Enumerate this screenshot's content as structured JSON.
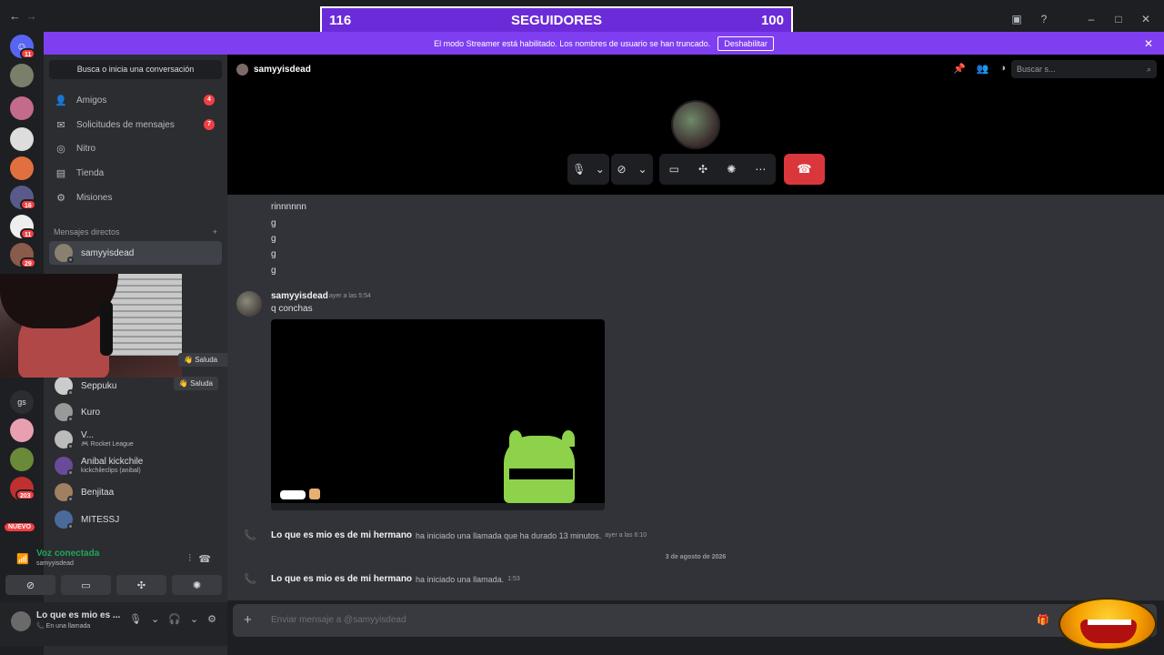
{
  "overlay": {
    "followers_left": "116",
    "followers_title": "SEGUIDORES",
    "followers_right": "100"
  },
  "titlebar": {
    "back_icon": "arrow-left-icon",
    "forward_icon": "arrow-right-icon"
  },
  "banner": {
    "text": "El modo Streamer está habilitado. Los nombres de usuario se han truncado.",
    "button": "Deshabilitar"
  },
  "servers": {
    "badges": [
      "11",
      "16",
      "11",
      "29",
      "203"
    ],
    "gs_label": "gs",
    "new_label": "NUEVO"
  },
  "dm_panel": {
    "search_placeholder": "Busca o inicia una conversación",
    "nav": [
      {
        "label": "Amigos",
        "badge": "4",
        "icon": "people-icon"
      },
      {
        "label": "Solicitudes de mensajes",
        "badge": "7",
        "icon": "mail-icon"
      },
      {
        "label": "Nitro",
        "icon": "nitro-icon"
      },
      {
        "label": "Tienda",
        "icon": "shop-icon"
      },
      {
        "label": "Misiones",
        "icon": "quest-icon"
      }
    ],
    "dm_header": "Mensajes directos",
    "dms": [
      {
        "name": "samyyisdead",
        "sub": ""
      },
      {
        "name": "Seppuku",
        "sub": ""
      },
      {
        "name": "Kuro",
        "sub": ""
      },
      {
        "name": "V...",
        "sub": "Rocket League"
      },
      {
        "name": "Anibal kickchile",
        "sub": "kickchileclips (anibal)"
      },
      {
        "name": "Benjitaa",
        "sub": ""
      },
      {
        "name": "MITESSJ",
        "sub": ""
      }
    ],
    "saluda_label": "Saluda"
  },
  "voice": {
    "title": "Voz conectada",
    "channel": "samyyisdead"
  },
  "user": {
    "name": "Lo que es mio es ...",
    "status": "En una llamada"
  },
  "header": {
    "channel_name": "samyyisdead",
    "search_placeholder": "Buscar s..."
  },
  "chat": {
    "early_lines": [
      "rinnnnnn",
      "g",
      "g",
      "g",
      "g"
    ],
    "author": "samyyisdead",
    "timestamp": "ayer a las 5:54",
    "message": "q conchas",
    "call1": {
      "who": "Lo que es mio es de mi hermano",
      "text": "ha iniciado una llamada que ha durado 13 minutos.",
      "time": "ayer a las 6:10"
    },
    "date_divider": "3 de agosto de 2026",
    "call2": {
      "who": "Lo que es mio es de mi hermano",
      "text": "ha iniciado una llamada.",
      "time": "1:53"
    }
  },
  "composer": {
    "placeholder": "Enviar mensaje a @samyyisdead"
  },
  "colors": {
    "accent": "#7f3ff0",
    "danger": "#da373c",
    "online": "#23a55a",
    "overlay": "#6b2bd9"
  }
}
